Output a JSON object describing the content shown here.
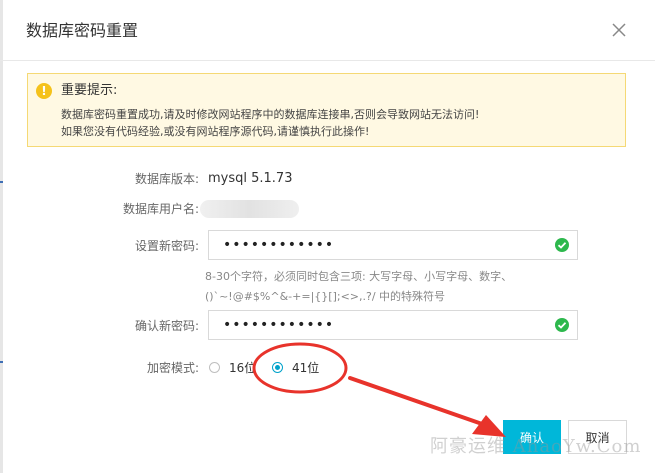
{
  "dialog": {
    "title": "数据库密码重置",
    "close_icon": "close-icon"
  },
  "notice": {
    "icon": "exclamation-icon",
    "icon_glyph": "!",
    "title": "重要提示:",
    "line1": "数据库密码重置成功,请及时修改网站程序中的数据库连接串,否则会导致网站无法访问!",
    "line2": "如果您没有代码经验,或没有网站程序源代码,请谨慎执行此操作!"
  },
  "form": {
    "db_version_label": "数据库版本:",
    "db_version_value": "mysql 5.1.73",
    "db_user_label": "数据库用户名:",
    "new_password_label": "设置新密码:",
    "new_password_value": "••••••••••••",
    "password_hint_line1": "8-30个字符，必须同时包含三项: 大写字母、小写字母、数字、",
    "password_hint_line2": "()`~!@#$%^&-+=|{}[];<>,.?/ 中的特殊符号",
    "confirm_password_label": "确认新密码:",
    "confirm_password_value": "••••••••••••",
    "encryption_label": "加密模式:",
    "encryption_options": [
      "16位",
      "41位"
    ],
    "encryption_selected": "41位"
  },
  "footer": {
    "confirm_label": "确认",
    "cancel_label": "取消"
  },
  "watermark": "阿豪运维 AhaoYw.Com",
  "colors": {
    "accent": "#00b7d9",
    "annotation_red": "#e8332b",
    "warning_bg": "#fff9e3",
    "warning_border": "#f5d975",
    "success": "#2db84d"
  }
}
